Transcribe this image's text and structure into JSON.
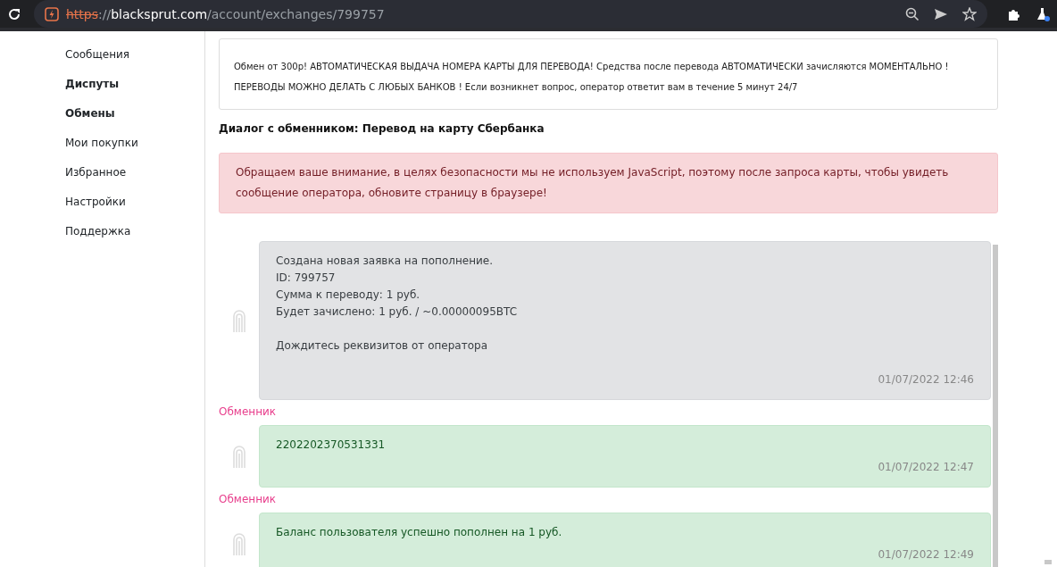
{
  "browser": {
    "url_scheme": "https",
    "url_separator": "://",
    "url_host": "blacksprut.com",
    "url_path": "/account/exchanges/799757",
    "scheme_insecure": true
  },
  "sidebar": {
    "items": [
      {
        "label": "Сообщения",
        "bold": false
      },
      {
        "label": "Диспуты",
        "bold": true
      },
      {
        "label": "Обмены",
        "bold": true
      },
      {
        "label": "Мои покупки",
        "bold": false
      },
      {
        "label": "Избранное",
        "bold": false
      },
      {
        "label": "Настройки",
        "bold": false
      },
      {
        "label": "Поддержка",
        "bold": false
      }
    ]
  },
  "notice": "Обмен от 300р! АВТОМАТИЧЕСКАЯ ВЫДАЧА НОМЕРА КАРТЫ ДЛЯ ПЕРЕВОДА! Средства после перевода АВТОМАТИЧЕСКИ зачисляются МОМЕНТАЛЬНО ! ПЕРЕВОДЫ МОЖНО ДЕЛАТЬ С ЛЮБЫХ БАНКОВ ! Если возникнет вопрос, оператор ответит вам в течение 5 минут 24/7",
  "dialog_title": "Диалог с обменником: Перевод на карту Сбербанка",
  "alert": "Обращаем ваше внимание, в целях безопасности мы не используем JavaScript, поэтому после запроса карты, чтобы увидеть сообщение оператора, обновите страницу в браузере!",
  "messages": [
    {
      "kind": "system",
      "lines": [
        "Создана новая заявка на пополнение.",
        "ID: 799757",
        "Сумма к переводу: 1 руб.",
        "Будет зачислено: 1 руб. / ~0.00000095BTC"
      ],
      "note": "Дождитесь реквизитов от оператора",
      "time": "01/07/2022 12:46"
    },
    {
      "kind": "operator",
      "sender": "Обменник",
      "lines": [
        "2202202370531331"
      ],
      "time": "01/07/2022 12:47"
    },
    {
      "kind": "operator",
      "sender": "Обменник",
      "lines": [
        "Баланс пользователя успешно пополнен на 1 руб."
      ],
      "time": "01/07/2022 12:49"
    }
  ]
}
